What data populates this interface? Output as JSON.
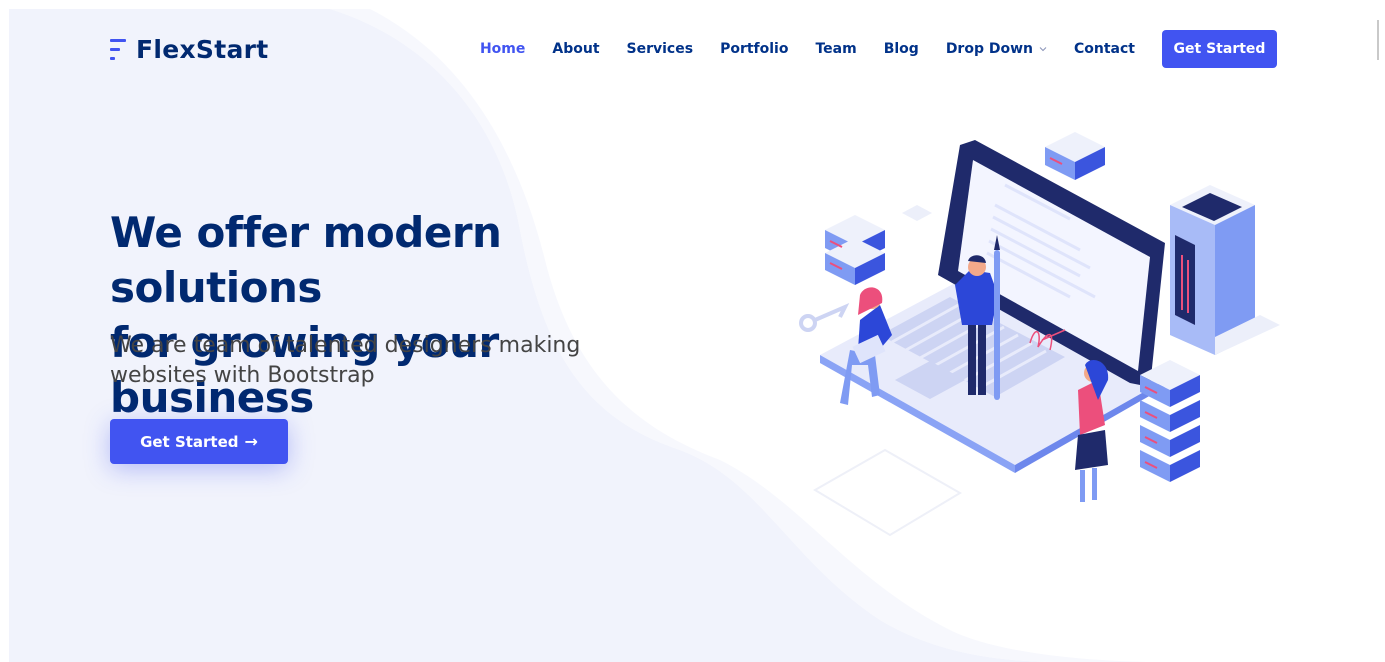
{
  "brand": {
    "name": "FlexStart",
    "accent": "#4154f1",
    "heading_color": "#012970",
    "nav_color": "#013289",
    "background": "#f4f6fd"
  },
  "nav": {
    "items": [
      {
        "label": "Home",
        "active": true
      },
      {
        "label": "About"
      },
      {
        "label": "Services"
      },
      {
        "label": "Portfolio"
      },
      {
        "label": "Team"
      },
      {
        "label": "Blog"
      },
      {
        "label": "Drop Down",
        "dropdown": true,
        "icon": "chevron-down-icon"
      },
      {
        "label": "Contact"
      }
    ],
    "cta_label": "Get Started"
  },
  "hero": {
    "title_line1": "We offer modern solutions",
    "title_line2": "for growing your business",
    "subtitle": "We are team of talented designers making websites with Bootstrap",
    "button_label": "Get Started",
    "button_icon": "arrow-right-icon"
  },
  "illustration": {
    "icon": "team-working-laptop-illustration"
  }
}
